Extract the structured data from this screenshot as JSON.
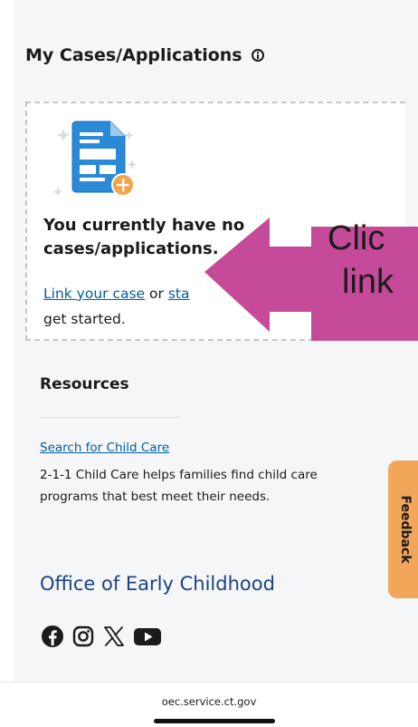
{
  "cases": {
    "title": "My Cases/Applications",
    "empty_message": "You currently have no cases/applications.",
    "link_case_label": "Link your case",
    "or_text": " or ",
    "start_label": "sta",
    "get_started_text": " get started."
  },
  "callout": {
    "line1": "Clic",
    "line2": "link"
  },
  "resources": {
    "title": "Resources",
    "items": [
      {
        "link": "Search for Child Care",
        "description": "2-1-1 Child Care helps families find child care programs that best meet their needs."
      }
    ]
  },
  "feedback": {
    "label": "Feedback"
  },
  "footer": {
    "agency": "Office of Early Childhood",
    "social_icons": [
      "facebook-icon",
      "instagram-icon",
      "x-icon",
      "youtube-icon"
    ]
  },
  "browser": {
    "url": "oec.service.ct.gov"
  },
  "colors": {
    "link": "#005ea2",
    "agency": "#1a4480",
    "callout_arrow": "#c54b9a",
    "feedback": "#f2a65a",
    "icon_blue": "#2b8ad8",
    "icon_orange": "#f5a448"
  }
}
